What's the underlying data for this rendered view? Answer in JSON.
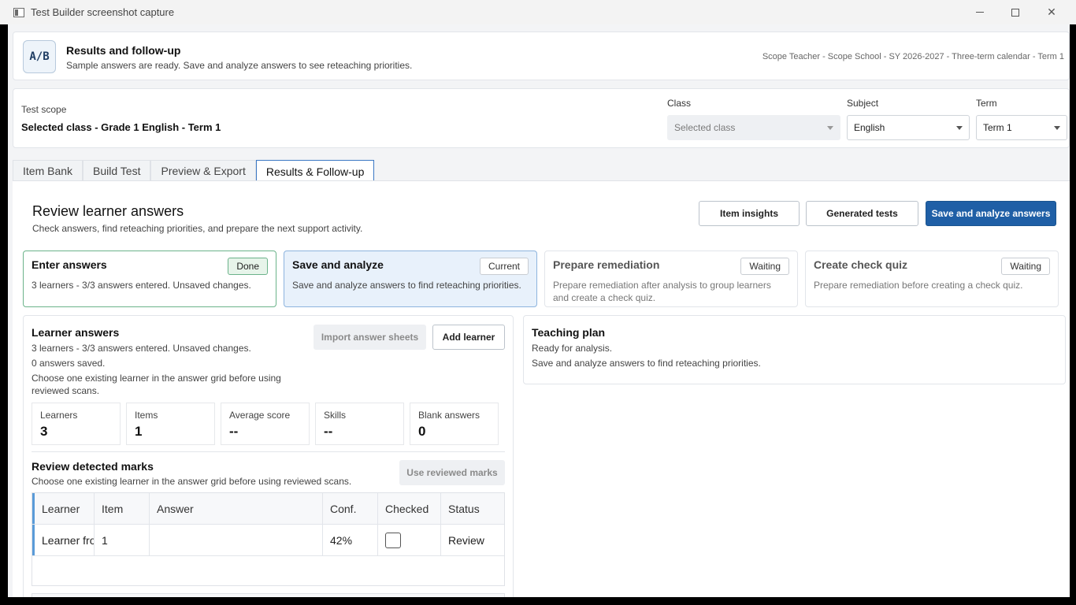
{
  "window": {
    "title": "Test Builder screenshot capture"
  },
  "header": {
    "logo": "A/B",
    "title": "Results and follow-up",
    "subtitle": "Sample answers are ready. Save and analyze answers to see reteaching priorities.",
    "scope_line": "Scope Teacher - Scope School - SY 2026-2027 - Three-term calendar - Term 1"
  },
  "scope": {
    "label": "Test scope",
    "value": "Selected class - Grade 1 English - Term 1",
    "class_label": "Class",
    "class_value": "Selected class",
    "subject_label": "Subject",
    "subject_value": "English",
    "term_label": "Term",
    "term_value": "Term 1"
  },
  "tabs": [
    "Item Bank",
    "Build Test",
    "Preview & Export",
    "Results & Follow-up"
  ],
  "main": {
    "title": "Review learner answers",
    "subtitle": "Check answers, find reteaching priorities, and prepare the next support activity.",
    "buttons": {
      "insights": "Item insights",
      "generated": "Generated tests",
      "save": "Save and analyze answers"
    }
  },
  "steps": [
    {
      "title": "Enter answers",
      "badge": "Done",
      "desc": "3 learners - 3/3 answers entered. Unsaved changes."
    },
    {
      "title": "Save and analyze",
      "badge": "Current",
      "desc": "Save and analyze answers to find reteaching priorities."
    },
    {
      "title": "Prepare remediation",
      "badge": "Waiting",
      "desc": "Prepare remediation after analysis to group learners and create a check quiz."
    },
    {
      "title": "Create check quiz",
      "badge": "Waiting",
      "desc": "Prepare remediation before creating a check quiz."
    }
  ],
  "answers": {
    "title": "Learner answers",
    "line1": "3 learners - 3/3 answers entered. Unsaved changes.",
    "line2": "0 answers saved.",
    "line3": "Choose one existing learner in the answer grid before using reviewed scans.",
    "import_button": "Import answer sheets",
    "add_button": "Add learner",
    "stats": [
      {
        "label": "Learners",
        "value": "3"
      },
      {
        "label": "Items",
        "value": "1"
      },
      {
        "label": "Average score",
        "value": "--"
      },
      {
        "label": "Skills",
        "value": "--"
      },
      {
        "label": "Blank answers",
        "value": "0"
      }
    ]
  },
  "marks": {
    "title": "Review detected marks",
    "subtitle": "Choose one existing learner in the answer grid before using reviewed scans.",
    "use_button": "Use reviewed marks",
    "columns": [
      "Learner",
      "Item",
      "Answer",
      "Conf.",
      "Checked",
      "Status"
    ],
    "row": {
      "learner": "Learner from",
      "item": "1",
      "answer": "",
      "conf": "42%",
      "status": "Review"
    }
  },
  "plan": {
    "title": "Teaching plan",
    "line1": "Ready for analysis.",
    "line2": "Save and analyze answers to find reteaching priorities."
  }
}
